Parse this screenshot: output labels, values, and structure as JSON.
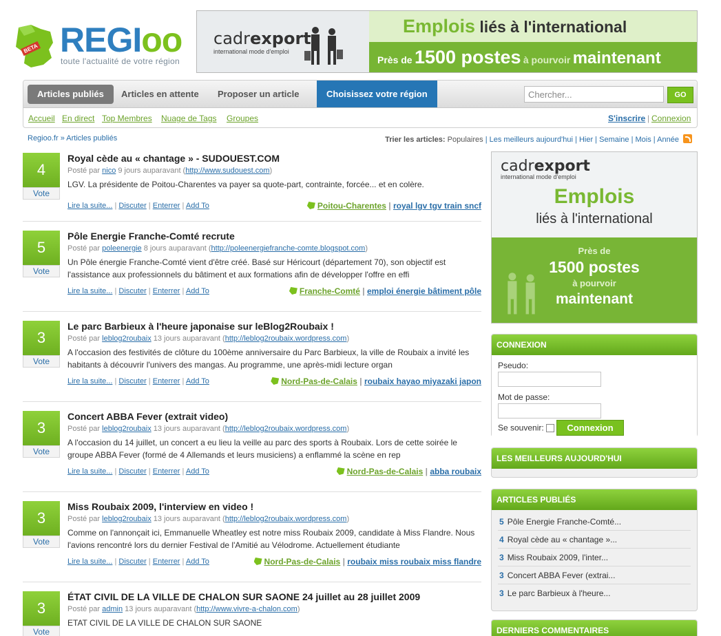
{
  "header": {
    "logo_text_1": "REGI",
    "logo_text_2": "oo",
    "logo_badge": "BETA",
    "tagline": "toute l'actualité de votre région",
    "banner": {
      "brand_1": "cadr",
      "brand_2": "export",
      "brand_sub": "international mode d'emploi",
      "line1_a": "Emplois",
      "line1_b": " liés à l'international",
      "line2_a": "Près de",
      "line2_b": "1500 postes",
      "line2_c": "à pourvoir",
      "line2_d": "maintenant"
    }
  },
  "nav": {
    "tabs": [
      {
        "label": "Articles publiés"
      },
      {
        "label": "Articles en attente"
      },
      {
        "label": "Proposer un article"
      },
      {
        "label": "Choisissez votre région"
      }
    ],
    "search_placeholder": "Chercher...",
    "go_label": "GO",
    "links": [
      "Accueil",
      "En direct",
      "Top Membres",
      "Nuage de Tags",
      "Groupes"
    ],
    "signup": "S'inscrire",
    "login": "Connexion"
  },
  "breadcrumb": "Regioo.fr » Articles publiés",
  "sort": {
    "label": "Trier les articles:",
    "current": "Populaires",
    "options": [
      "Les meilleurs aujourd'hui",
      "Hier",
      "Semaine",
      "Mois",
      "Année"
    ]
  },
  "articles": [
    {
      "votes": "4",
      "vote_label": "Vote",
      "title": "Royal cède au « chantage » - SUDOUEST.COM",
      "meta_prefix": "Posté par ",
      "author": "nico",
      "when": " 9 jours auparavant (",
      "url": "http://www.sudouest.com",
      "meta_suffix": ")",
      "desc": "LGV. La présidente de Poitou-Charentes va payer sa quote-part, contrainte, forcée... et en colère.",
      "actions": [
        "Lire la suite...",
        "Discuter",
        "Enterrer",
        "Add To"
      ],
      "region": "Poitou-Charentes",
      "tags": "royal lgv tgv train sncf"
    },
    {
      "votes": "5",
      "vote_label": "Vote",
      "title": "Pôle Energie Franche-Comté recrute",
      "meta_prefix": "Posté par ",
      "author": "poleenergie",
      "when": " 8 jours auparavant (",
      "url": "http://poleenergiefranche-comte.blogspot.com",
      "meta_suffix": ")",
      "desc": "Un Pôle énergie Franche-Comté vient d'être créé. Basé sur Héricourt (département 70), son objectif est l'assistance aux professionnels du bâtiment et aux formations afin de développer l'offre en effi",
      "actions": [
        "Lire la suite...",
        "Discuter",
        "Enterrer",
        "Add To"
      ],
      "region": "Franche-Comté",
      "tags": "emploi énergie bâtiment pôle"
    },
    {
      "votes": "3",
      "vote_label": "Vote",
      "title": "Le parc Barbieux à l'heure japonaise sur leBlog2Roubaix !",
      "meta_prefix": "Posté par ",
      "author": "leblog2roubaix",
      "when": " 13 jours auparavant (",
      "url": "http://leblog2roubaix.wordpress.com",
      "meta_suffix": ")",
      "desc": "A l'occasion des festivités de clôture du 100ème anniversaire du Parc Barbieux, la ville de Roubaix a invité les habitants à découvrir l'univers des mangas. Au programme, une après-midi lecture organ",
      "actions": [
        "Lire la suite...",
        "Discuter",
        "Enterrer",
        "Add To"
      ],
      "region": "Nord-Pas-de-Calais",
      "tags": "roubaix hayao miyazaki japon"
    },
    {
      "votes": "3",
      "vote_label": "Vote",
      "title": "Concert ABBA Fever (extrait video)",
      "meta_prefix": "Posté par ",
      "author": "leblog2roubaix",
      "when": " 13 jours auparavant (",
      "url": "http://leblog2roubaix.wordpress.com",
      "meta_suffix": ")",
      "desc": "A l'occasion du 14 juillet, un concert a eu lieu la veille au parc des sports à Roubaix. Lors de cette soirée le groupe ABBA Fever (formé de 4 Allemands et leurs musiciens) a enflammé la scène en rep",
      "actions": [
        "Lire la suite...",
        "Discuter",
        "Enterrer",
        "Add To"
      ],
      "region": "Nord-Pas-de-Calais",
      "tags": "abba roubaix"
    },
    {
      "votes": "3",
      "vote_label": "Vote",
      "title": "Miss Roubaix 2009, l'interview en video !",
      "meta_prefix": "Posté par ",
      "author": "leblog2roubaix",
      "when": " 13 jours auparavant (",
      "url": "http://leblog2roubaix.wordpress.com",
      "meta_suffix": ")",
      "desc": "Comme on l'annonçait ici, Emmanuelle Wheatley est notre miss Roubaix 2009, candidate à Miss Flandre. Nous l'avions rencontré lors du dernier Festival de l'Amitié au Vélodrome. Actuellement étudiante",
      "actions": [
        "Lire la suite...",
        "Discuter",
        "Enterrer",
        "Add To"
      ],
      "region": "Nord-Pas-de-Calais",
      "tags": "roubaix miss roubaix miss flandre"
    },
    {
      "votes": "3",
      "vote_label": "Vote",
      "title": "ÉTAT CIVIL DE LA VILLE DE CHALON SUR SAONE 24 juillet au 28 juillet 2009",
      "meta_prefix": "Posté par ",
      "author": "admin",
      "when": " 13 jours auparavant (",
      "url": "http://www.vivre-a-chalon.com",
      "meta_suffix": ")",
      "desc": "ETAT CIVIL DE LA VILLE DE CHALON SUR SAONE"
    }
  ],
  "sidebar": {
    "ad": {
      "brand_1": "cadr",
      "brand_2": "export",
      "brand_sub": "international mode d'emploi",
      "l1": "Emplois",
      "l2": "liés à l'international",
      "l3": "Près de",
      "l4": "1500 postes",
      "l5": "à pourvoir",
      "l6": "maintenant"
    },
    "login": {
      "title": "CONNEXION",
      "pseudo_label": "Pseudo:",
      "password_label": "Mot de passe:",
      "remember_label": "Se souvenir:",
      "button": "Connexion"
    },
    "best_title": "LES MEILLEURS AUJOURD'HUI",
    "published_title": "ARTICLES PUBLIÉS",
    "published": [
      {
        "n": "5",
        "t": "Pôle Energie Franche-Comté..."
      },
      {
        "n": "4",
        "t": "Royal cède au « chantage »..."
      },
      {
        "n": "3",
        "t": "Miss Roubaix 2009, l'inter..."
      },
      {
        "n": "3",
        "t": "Concert ABBA Fever (extrai..."
      },
      {
        "n": "3",
        "t": "Le parc Barbieux à l'heure..."
      }
    ],
    "comments_title": "DERNIERS COMMENTAIRES"
  },
  "colors": {
    "accent_green": "#79c11f",
    "link_blue": "#2a6ea8",
    "region_tab": "#2676b5"
  }
}
